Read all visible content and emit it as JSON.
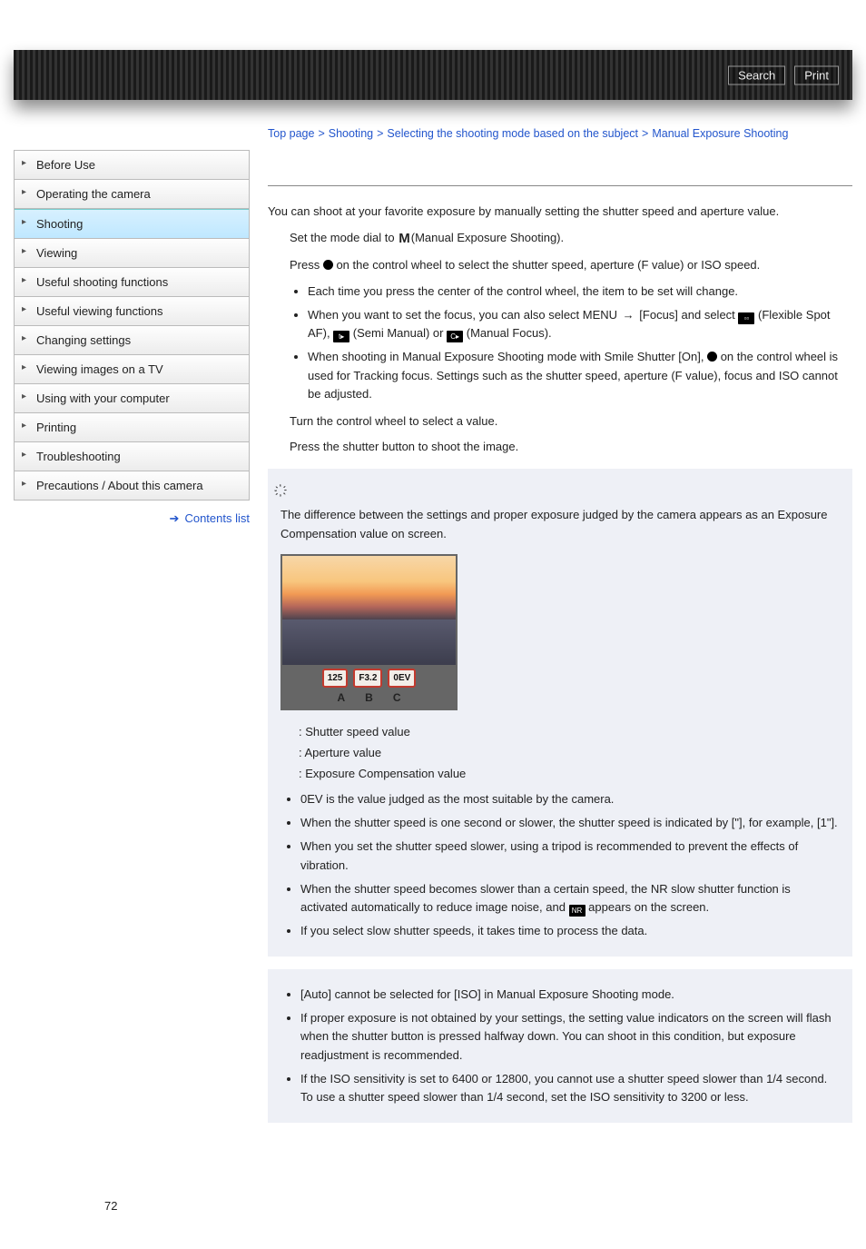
{
  "header": {
    "search": "Search",
    "print": "Print"
  },
  "breadcrumb": {
    "top": "Top page",
    "shooting": "Shooting",
    "mode": "Selecting the shooting mode based on the subject",
    "current": "Manual Exposure Shooting"
  },
  "sidebar": {
    "items": [
      "Before Use",
      "Operating the camera",
      "Shooting",
      "Viewing",
      "Useful shooting functions",
      "Useful viewing functions",
      "Changing settings",
      "Viewing images on a TV",
      "Using with your computer",
      "Printing",
      "Troubleshooting",
      "Precautions / About this camera"
    ],
    "active_index": 2,
    "contents_list": "Contents list"
  },
  "content": {
    "intro": "You can shoot at your favorite exposure by manually setting the shutter speed and aperture value.",
    "step1_pre": "Set the mode dial to ",
    "step1_post": "(Manual Exposure Shooting).",
    "step2_pre": "Press ",
    "step2_post": " on the control wheel to select the shutter speed, aperture (F value) or ISO speed.",
    "sub1": "Each time you press the center of the control wheel, the item to be set will change.",
    "sub2_a": "When you want to set the focus, you can also select MENU ",
    "sub2_b": " [Focus] and select ",
    "sub2_c": "(Flexible Spot AF), ",
    "sub2_d": "(Semi Manual) or ",
    "sub2_e": "(Manual Focus).",
    "sub3_a": "When shooting in Manual Exposure Shooting mode with Smile Shutter [On], ",
    "sub3_b": " on the control wheel is used for Tracking focus. Settings such as the shutter speed, aperture (F value), focus and ISO cannot be adjusted.",
    "step3": "Turn the control wheel to select a value.",
    "step4": "Press the shutter button to shoot the image.",
    "tip_intro": "The difference between the settings and proper exposure judged by the camera appears as an Exposure Compensation value on screen.",
    "sample": {
      "a": "125",
      "b": "F3.2",
      "c": "0EV",
      "la": "A",
      "lb": "B",
      "lc": "C"
    },
    "defs": {
      "a": ": Shutter speed value",
      "b": ": Aperture value",
      "c": ": Exposure Compensation value"
    },
    "tips": [
      "0EV is the value judged as the most suitable by the camera.",
      "When the shutter speed is one second or slower, the shutter speed is indicated by [\"], for example, [1\"].",
      "When you set the shutter speed slower, using a tripod is recommended to prevent the effects of vibration.",
      "",
      "If you select slow shutter speeds, it takes time to process the data."
    ],
    "tip4_a": "When the shutter speed becomes slower than a certain speed, the NR slow shutter function is activated automatically to reduce image noise, and ",
    "tip4_b": " appears on the screen.",
    "notes": [
      "[Auto] cannot be selected for [ISO] in Manual Exposure Shooting mode.",
      "If proper exposure is not obtained by your settings, the setting value indicators on the screen will flash when the shutter button is pressed halfway down. You can shoot in this condition, but exposure readjustment is recommended.",
      "If the ISO sensitivity is set to 6400 or 12800, you cannot use a shutter speed slower than 1/4 second. To use a shutter speed slower than 1/4 second, set the ISO sensitivity to 3200 or less."
    ]
  },
  "page_number": "72"
}
